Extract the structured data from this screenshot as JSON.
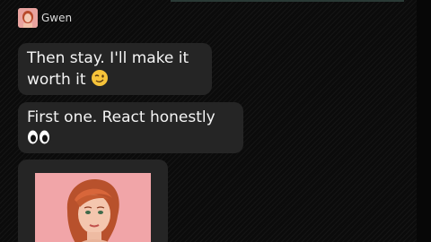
{
  "chat": {
    "sender_name": "Gwen",
    "messages": [
      {
        "text": "Then stay. I'll make it worth it",
        "emoji": "winking-face"
      },
      {
        "text": "First one. React honestly",
        "emoji": "eyes"
      }
    ],
    "image_message": {
      "description_icon": "portrait-photo"
    }
  },
  "colors": {
    "background": "#0b0b0b",
    "bubble": "#252525",
    "text": "#f4f4f4",
    "photo_background": "#f1a5a8"
  }
}
